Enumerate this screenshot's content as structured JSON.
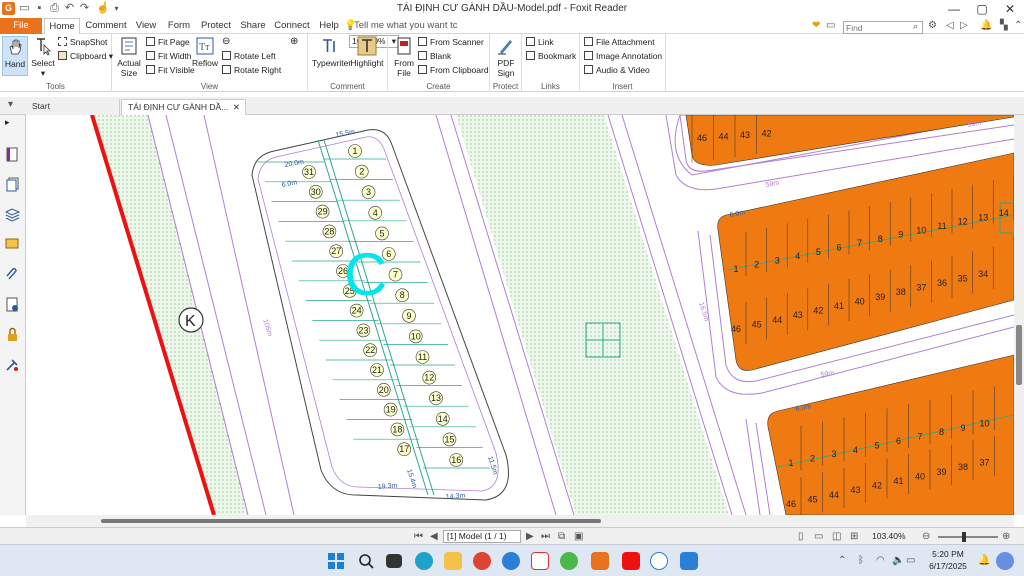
{
  "window": {
    "title": "TÁI ĐỊNH CƯ GÀNH DẦU-Model.pdf - Foxit Reader"
  },
  "menu": {
    "file": "File",
    "home": "Home",
    "comment": "Comment",
    "view": "View",
    "form": "Form",
    "protect": "Protect",
    "share": "Share",
    "connect": "Connect",
    "help": "Help",
    "tellme": "Tell me what you want tc",
    "find_placeholder": "Find"
  },
  "ribbon": {
    "tools": {
      "hand": "Hand",
      "select": "Select",
      "snapshot": "SnapShot",
      "clipboard": "Clipboard",
      "label": "Tools"
    },
    "view": {
      "actual_size": "Actual Size",
      "fit_page": "Fit Page",
      "fit_width": "Fit Width",
      "fit_visible": "Fit Visible",
      "reflow": "Reflow",
      "zoom": "103.40%",
      "rotate_left": "Rotate Left",
      "rotate_right": "Rotate Right",
      "label": "View"
    },
    "comment": {
      "typewriter": "Typewriter",
      "highlight": "Highlight",
      "label": "Comment"
    },
    "create": {
      "from_file": "From File",
      "from_scanner": "From Scanner",
      "blank": "Blank",
      "from_clipboard": "From Clipboard",
      "label": "Create"
    },
    "protect": {
      "pdf_sign": "PDF Sign",
      "label": "Protect"
    },
    "links": {
      "link": "Link",
      "bookmark": "Bookmark",
      "label": "Links"
    },
    "insert": {
      "file_attachment": "File Attachment",
      "image_annotation": "Image Annotation",
      "audio_video": "Audio & Video",
      "label": "Insert"
    }
  },
  "tabs": {
    "start": "Start",
    "doc": "TÁI ĐỊNH CƯ GÀNH DẦ..."
  },
  "map": {
    "block_c_label": "C",
    "block_k_label": "K",
    "lots_left": [
      "31",
      "30",
      "29",
      "28",
      "27",
      "26",
      "25",
      "24",
      "23",
      "22",
      "21",
      "20",
      "19",
      "18",
      "17"
    ],
    "lots_right": [
      "1",
      "2",
      "3",
      "4",
      "5",
      "6",
      "7",
      "8",
      "9",
      "10",
      "11",
      "12",
      "13",
      "14",
      "15",
      "16"
    ],
    "top_row": [
      "46",
      "44",
      "43",
      "42"
    ],
    "row_mid_front": [
      "1",
      "2",
      "3",
      "4",
      "5",
      "6",
      "7",
      "8",
      "9",
      "10",
      "11",
      "12",
      "13",
      "14"
    ],
    "row_mid_back": [
      "46",
      "45",
      "44",
      "43",
      "42",
      "41",
      "40",
      "39",
      "38",
      "37",
      "36",
      "35",
      "34"
    ],
    "row_bot_front": [
      "1",
      "2",
      "3",
      "4",
      "5",
      "6",
      "7",
      "8",
      "9",
      "10"
    ],
    "row_bot_back": [
      "46",
      "45",
      "44",
      "43",
      "42",
      "41",
      "40",
      "39",
      "38",
      "37"
    ],
    "dims": {
      "road59": "59m",
      "road105": "105m",
      "road165": "16.5m",
      "m6": "6.0m",
      "m20": "20.0m",
      "m155": "15.5m",
      "m154": "15.4m",
      "m193": "19.3m",
      "m143": "14.3m",
      "m115": "11.5m"
    }
  },
  "status": {
    "page": "[1] Model (1 / 1)",
    "zoom": "103.40%"
  },
  "taskbar": {
    "time": "5:20 PM",
    "date": "6/17/2025"
  },
  "colors": {
    "accent": "#e8731c",
    "lot_fill": "#f07a12",
    "green": "#e4f2e0",
    "road": "#b07fd0",
    "boundary": "#ee1111",
    "teal": "#2aa88c"
  }
}
